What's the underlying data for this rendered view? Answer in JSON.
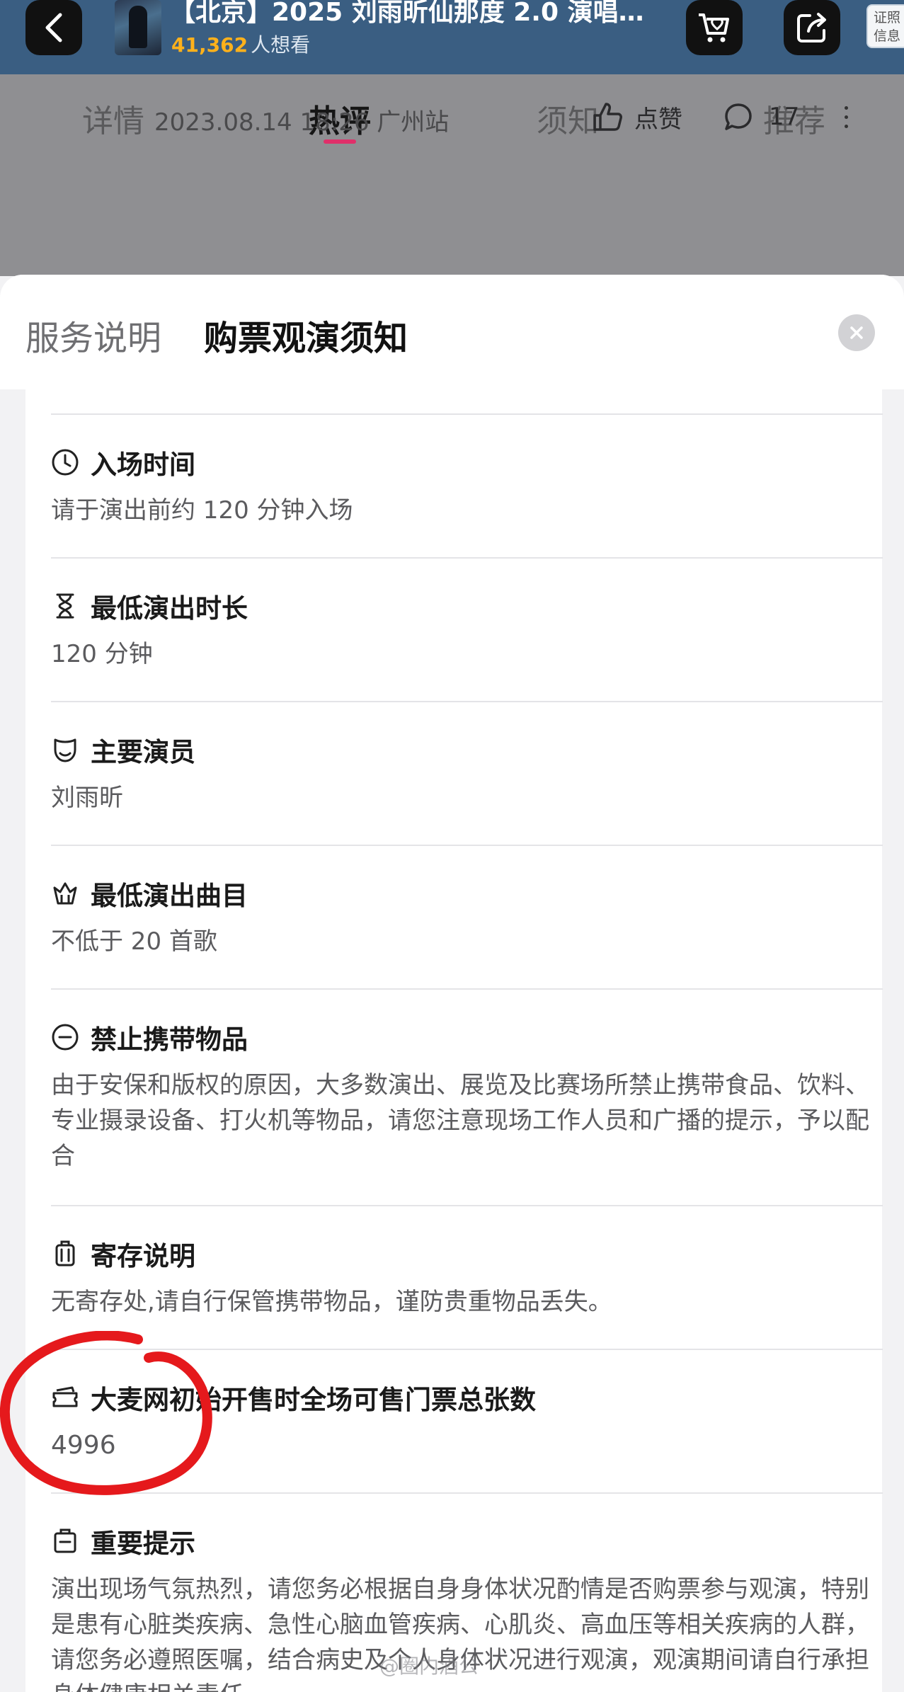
{
  "header": {
    "title": "【北京】2025 刘雨昕仙那度 2.0 演唱…",
    "want_count": "41,362",
    "want_label": "人想看",
    "cert_label": "证照信息",
    "back_icon": "back-icon",
    "cart_icon": "heart-cart-icon",
    "share_icon": "share-icon"
  },
  "tabs": [
    {
      "label": "详情"
    },
    {
      "label": "热评"
    },
    {
      "label": "须知"
    },
    {
      "label": "推荐"
    }
  ],
  "comment": {
    "meta": "2023.08.14 18:26 广州站",
    "like_label": "点赞",
    "comment_count": "17"
  },
  "sheet": {
    "tab_service": "服务说明",
    "tab_notice": "购票观演须知"
  },
  "sections": [
    {
      "icon": "clock-icon",
      "title": "入场时间",
      "body": "请于演出前约 120 分钟入场"
    },
    {
      "icon": "hourglass-icon",
      "title": "最低演出时长",
      "body": "120 分钟"
    },
    {
      "icon": "mask-icon",
      "title": "主要演员",
      "body": "刘雨昕"
    },
    {
      "icon": "crown-icon",
      "title": "最低演出曲目",
      "body": "不低于 20 首歌"
    },
    {
      "icon": "prohibited-icon",
      "title": "禁止携带物品",
      "body": "由于安保和版权的原因，大多数演出、展览及比赛场所禁止携带食品、饮料、专业摄录设备、打火机等物品，请您注意现场工作人员和广播的提示，予以配合"
    },
    {
      "icon": "luggage-icon",
      "title": "寄存说明",
      "body": "无寄存处,请自行保管携带物品，谨防贵重物品丢失。"
    },
    {
      "icon": "ticket-icon",
      "title": "大麦网初始开售时全场可售门票总张数",
      "body": "4996"
    },
    {
      "icon": "notice-icon",
      "title": "重要提示",
      "body": "演出现场气氛热烈，请您务必根据自身身体状况酌情是否购票参与观演，特别是患有心脏类疾病、急性心脑血管疾病、心肌炎、高血压等相关疾病的人群，请您务必遵照医嘱，结合病史及个人身体状况进行观演，观演期间请自行承担身体健康相关责任。"
    }
  ],
  "watermark": "@圈内酒公"
}
